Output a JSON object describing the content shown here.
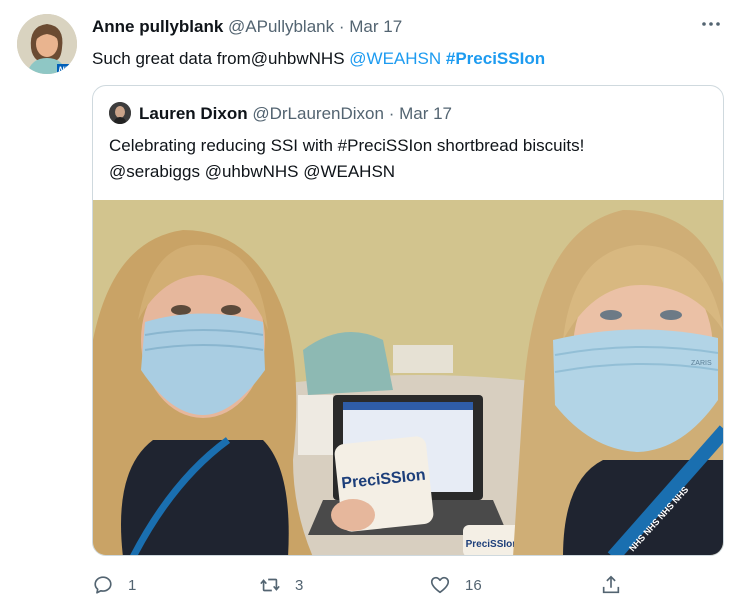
{
  "tweet": {
    "author_name": "Anne pullyblank",
    "author_handle": "@APullyblank",
    "separator": "·",
    "date": "Mar 17",
    "text_plain": "Such great data from@uhbwNHS ",
    "mention": "@WEAHSN",
    "hashtag": "#PreciSSIon",
    "avatar_badge": "NHS"
  },
  "quote": {
    "author_name": "Lauren Dixon",
    "author_handle": "@DrLaurenDixon",
    "separator": "·",
    "date": "Mar 17",
    "line1": "Celebrating reducing SSI with #PreciSSIon shortbread biscuits!",
    "line2": "@serabiggs @uhbwNHS @WEAHSN",
    "photo": {
      "biscuit_label": "PreciSSIon",
      "biscuit_label_small": "PreciSSIon",
      "lanyard_text": "NHS NHS NHS NHS",
      "mask_brand": "ZARIS"
    }
  },
  "actions": {
    "reply_count": "1",
    "retweet_count": "3",
    "like_count": "16"
  },
  "colors": {
    "accent": "#1d9bf0",
    "text": "#0f1419",
    "muted": "#536471",
    "border": "#cfd9de"
  },
  "icons": [
    "more-icon",
    "reply-icon",
    "retweet-icon",
    "like-icon",
    "share-icon"
  ]
}
